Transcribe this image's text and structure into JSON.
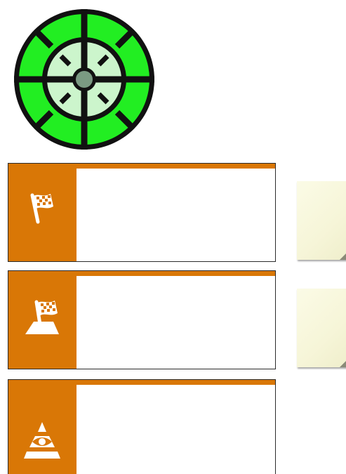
{
  "logo": {
    "icon": "target-crosshair-icon",
    "colors": {
      "ring": "#22ee22",
      "inner": "#ccf5cc",
      "outline": "#111111",
      "center": "#7a9a82"
    }
  },
  "accent_color": "#d97706",
  "cards": [
    {
      "icon": "checkered-flag-icon",
      "text": ""
    },
    {
      "icon": "flag-on-mound-icon",
      "text": ""
    },
    {
      "icon": "eye-pyramid-icon",
      "text": ""
    }
  ],
  "notes": [
    {
      "text": ""
    },
    {
      "text": ""
    }
  ]
}
